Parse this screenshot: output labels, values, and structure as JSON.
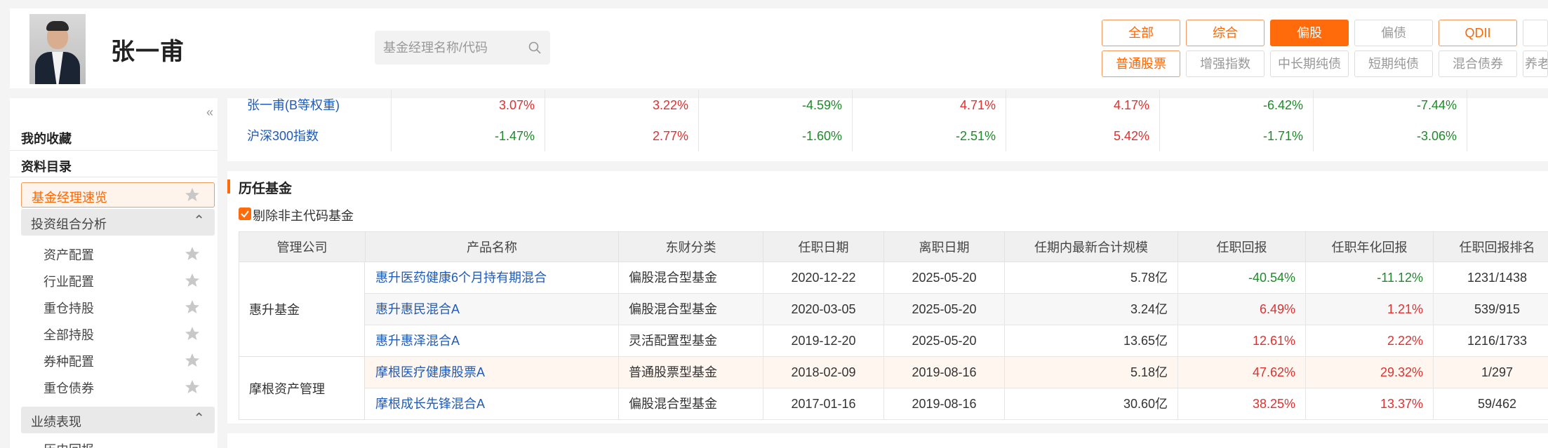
{
  "manager": {
    "name": "张一甫"
  },
  "search": {
    "placeholder": "基金经理名称/代码"
  },
  "categories_row1": [
    "全部",
    "综合",
    "偏股",
    "偏债",
    "QDII",
    ""
  ],
  "categories_row2": [
    "普通股票",
    "增强指数",
    "中长期纯债",
    "短期纯债",
    "混合债券",
    "养老"
  ],
  "sidebar": {
    "favorites": "我的收藏",
    "catalog": "资料目录",
    "active_item": "基金经理速览",
    "group1": "投资组合分析",
    "group1_items": [
      "资产配置",
      "行业配置",
      "重仓持股",
      "全部持股",
      "券种配置",
      "重仓债券"
    ],
    "group2": "业绩表现",
    "group2_items": [
      "历史回报"
    ]
  },
  "top_table": {
    "rows": [
      {
        "name": "张一甫(B等权重)",
        "values": [
          "3.07%",
          "3.22%",
          "-4.59%",
          "4.71%",
          "4.17%",
          "-6.42%",
          "-7.44%"
        ]
      },
      {
        "name": "沪深300指数",
        "values": [
          "-1.47%",
          "2.77%",
          "-1.60%",
          "-2.51%",
          "5.42%",
          "-1.71%",
          "-3.06%"
        ]
      }
    ]
  },
  "history": {
    "title": "历任基金",
    "checkbox_label": "剔除非主代码基金",
    "headers": [
      "管理公司",
      "产品名称",
      "东财分类",
      "任职日期",
      "离职日期",
      "任期内最新合计规模",
      "任职回报",
      "任职年化回报",
      "任职回报排名"
    ],
    "companies": [
      "惠升基金",
      "摩根资产管理"
    ],
    "rows": [
      {
        "product": "惠升医药健康6个月持有期混合",
        "category": "偏股混合型基金",
        "start": "2020-12-22",
        "end": "2025-05-20",
        "size": "5.78亿",
        "return": "-40.54%",
        "annual": "-11.12%",
        "rank": "1231/1438"
      },
      {
        "product": "惠升惠民混合A",
        "category": "偏股混合型基金",
        "start": "2020-03-05",
        "end": "2025-05-20",
        "size": "3.24亿",
        "return": "6.49%",
        "annual": "1.21%",
        "rank": "539/915"
      },
      {
        "product": "惠升惠泽混合A",
        "category": "灵活配置型基金",
        "start": "2019-12-20",
        "end": "2025-05-20",
        "size": "13.65亿",
        "return": "12.61%",
        "annual": "2.22%",
        "rank": "1216/1733"
      },
      {
        "product": "摩根医疗健康股票A",
        "category": "普通股票型基金",
        "start": "2018-02-09",
        "end": "2019-08-16",
        "size": "5.18亿",
        "return": "47.62%",
        "annual": "29.32%",
        "rank": "1/297"
      },
      {
        "product": "摩根成长先锋混合A",
        "category": "偏股混合型基金",
        "start": "2017-01-16",
        "end": "2019-08-16",
        "size": "30.60亿",
        "return": "38.25%",
        "annual": "13.37%",
        "rank": "59/462"
      }
    ]
  },
  "colors": {
    "accent": "#ff6a0a",
    "positive": "#e03131",
    "negative": "#1f8a2a",
    "link": "#1f5bb8"
  }
}
